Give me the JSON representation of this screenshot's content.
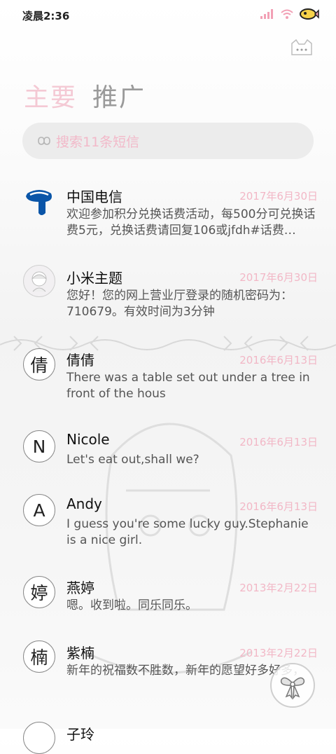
{
  "status_bar": {
    "time": "凌晨2:36"
  },
  "header": {
    "tabs": [
      {
        "label": "主要",
        "active": true
      },
      {
        "label": "推广",
        "active": false
      }
    ]
  },
  "search": {
    "placeholder": "搜索11条短信"
  },
  "conversations": [
    {
      "avatar": "logo",
      "name": "中国电信",
      "date": "2017年6月30日",
      "preview": "欢迎参加积分兑换话费活动，每500分可兑换话费5元，兑换话费请回复106或jfdh#话费…"
    },
    {
      "avatar": "photo",
      "name": "小米主题",
      "date": "2017年6月30日",
      "preview": "您好！您的网上营业厅登录的随机密码为：710679。有效时间为3分钟"
    },
    {
      "avatar": "倩",
      "name": "倩倩",
      "date": "2016年6月13日",
      "preview": "There was a table set out under a tree in front of the hous"
    },
    {
      "avatar": "N",
      "name": "Nicole",
      "date": "2016年6月13日",
      "preview": "Let's eat out,shall we?"
    },
    {
      "avatar": "A",
      "name": "Andy",
      "date": "2016年6月13日",
      "preview": "I guess you're some lucky guy.Stephanie is a nice girl."
    },
    {
      "avatar": "婷",
      "name": "燕婷",
      "date": "2013年2月22日",
      "preview": "嗯。收到啦。同乐同乐。"
    },
    {
      "avatar": "楠",
      "name": "紫楠",
      "date": "2013年2月22日",
      "preview": "新年的祝福数不胜数，新年的愿望好多好多，新年的问候依旧美好，在这个温馨的时"
    },
    {
      "avatar": "",
      "name": "子玲",
      "date": "",
      "preview": ""
    }
  ],
  "colors": {
    "accent_pink": "#f2b7c6",
    "tab_inactive": "#9a9a9a",
    "telecom_blue": "#0a55a8"
  }
}
